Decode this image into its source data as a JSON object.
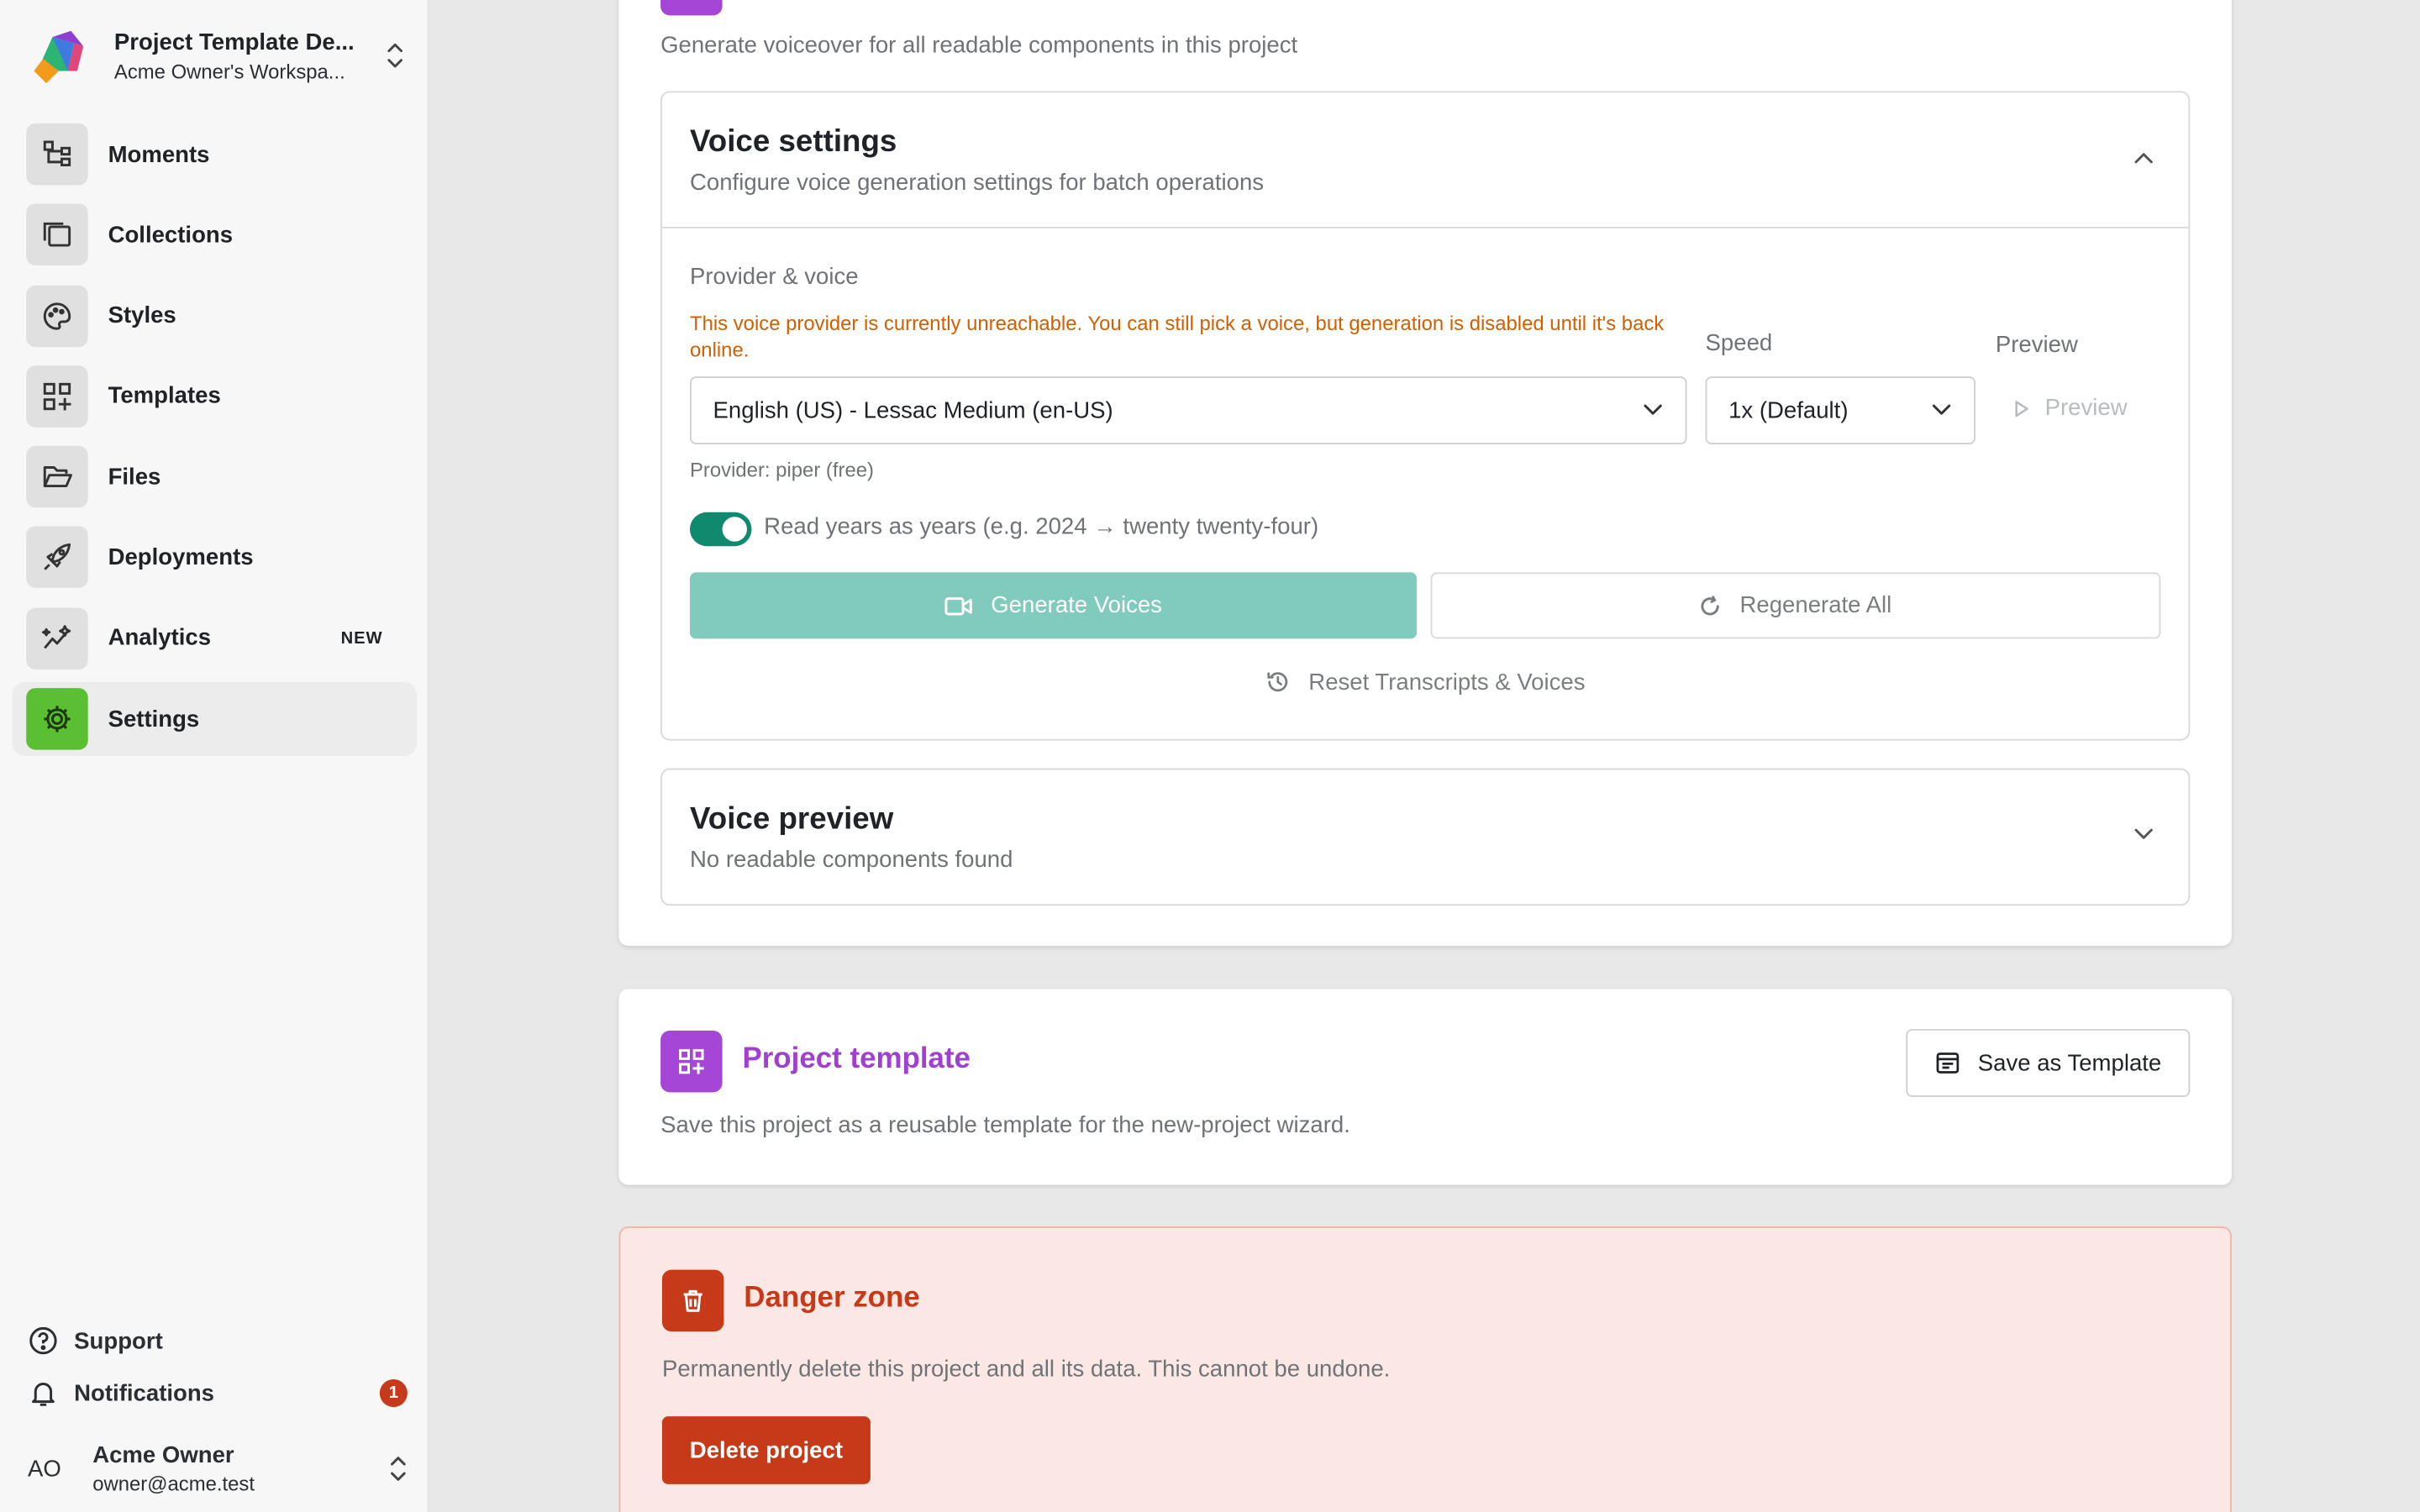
{
  "sidebar": {
    "project_name": "Project Template De...",
    "workspace": "Acme Owner's Workspa...",
    "nav": [
      {
        "label": "Moments",
        "icon": "hierarchy-icon",
        "active": false
      },
      {
        "label": "Collections",
        "icon": "collection-icon",
        "active": false
      },
      {
        "label": "Styles",
        "icon": "palette-icon",
        "active": false
      },
      {
        "label": "Templates",
        "icon": "grid-plus-icon",
        "active": false
      },
      {
        "label": "Files",
        "icon": "folder-open-icon",
        "active": false
      },
      {
        "label": "Deployments",
        "icon": "rocket-icon",
        "active": false
      },
      {
        "label": "Analytics",
        "icon": "sparkline-icon",
        "active": false,
        "badge": "NEW"
      },
      {
        "label": "Settings",
        "icon": "gear-icon",
        "active": true
      }
    ],
    "support_label": "Support",
    "notifications_label": "Notifications",
    "notifications_count": "1",
    "user": {
      "initials": "AO",
      "name": "Acme Owner",
      "email": "owner@acme.test"
    }
  },
  "voice": {
    "subtitle": "Generate voiceover for all readable components in this project",
    "settings_title": "Voice settings",
    "settings_desc": "Configure voice generation settings for batch operations",
    "provider_label": "Provider & voice",
    "warning": "This voice provider is currently unreachable. You can still pick a voice, but generation is disabled until it's back online.",
    "speed_label": "Speed",
    "preview_label": "Preview",
    "voice_value": "English (US) - Lessac Medium (en-US)",
    "speed_value": "1x (Default)",
    "preview_button": "Preview",
    "provider_info": "Provider: piper (free)",
    "toggle_label": "Read years as years (e.g. 2024 → twenty twenty-four)",
    "toggle_on": true,
    "generate_label": "Generate Voices",
    "regenerate_label": "Regenerate All",
    "reset_label": "Reset Transcripts & Voices",
    "preview_title": "Voice preview",
    "preview_desc": "No readable components found"
  },
  "template_card": {
    "title": "Project template",
    "desc": "Save this project as a reusable template for the new-project wizard.",
    "save_label": "Save as Template"
  },
  "danger": {
    "title": "Danger zone",
    "desc": "Permanently delete this project and all its data. This cannot be undone.",
    "delete_label": "Delete project"
  },
  "colors": {
    "accent_purple": "#a646d6",
    "danger_red": "#c63a1a",
    "settings_green": "#5bbf33",
    "toggle_teal": "#0f8a6e",
    "warning_orange": "#d45f00"
  }
}
